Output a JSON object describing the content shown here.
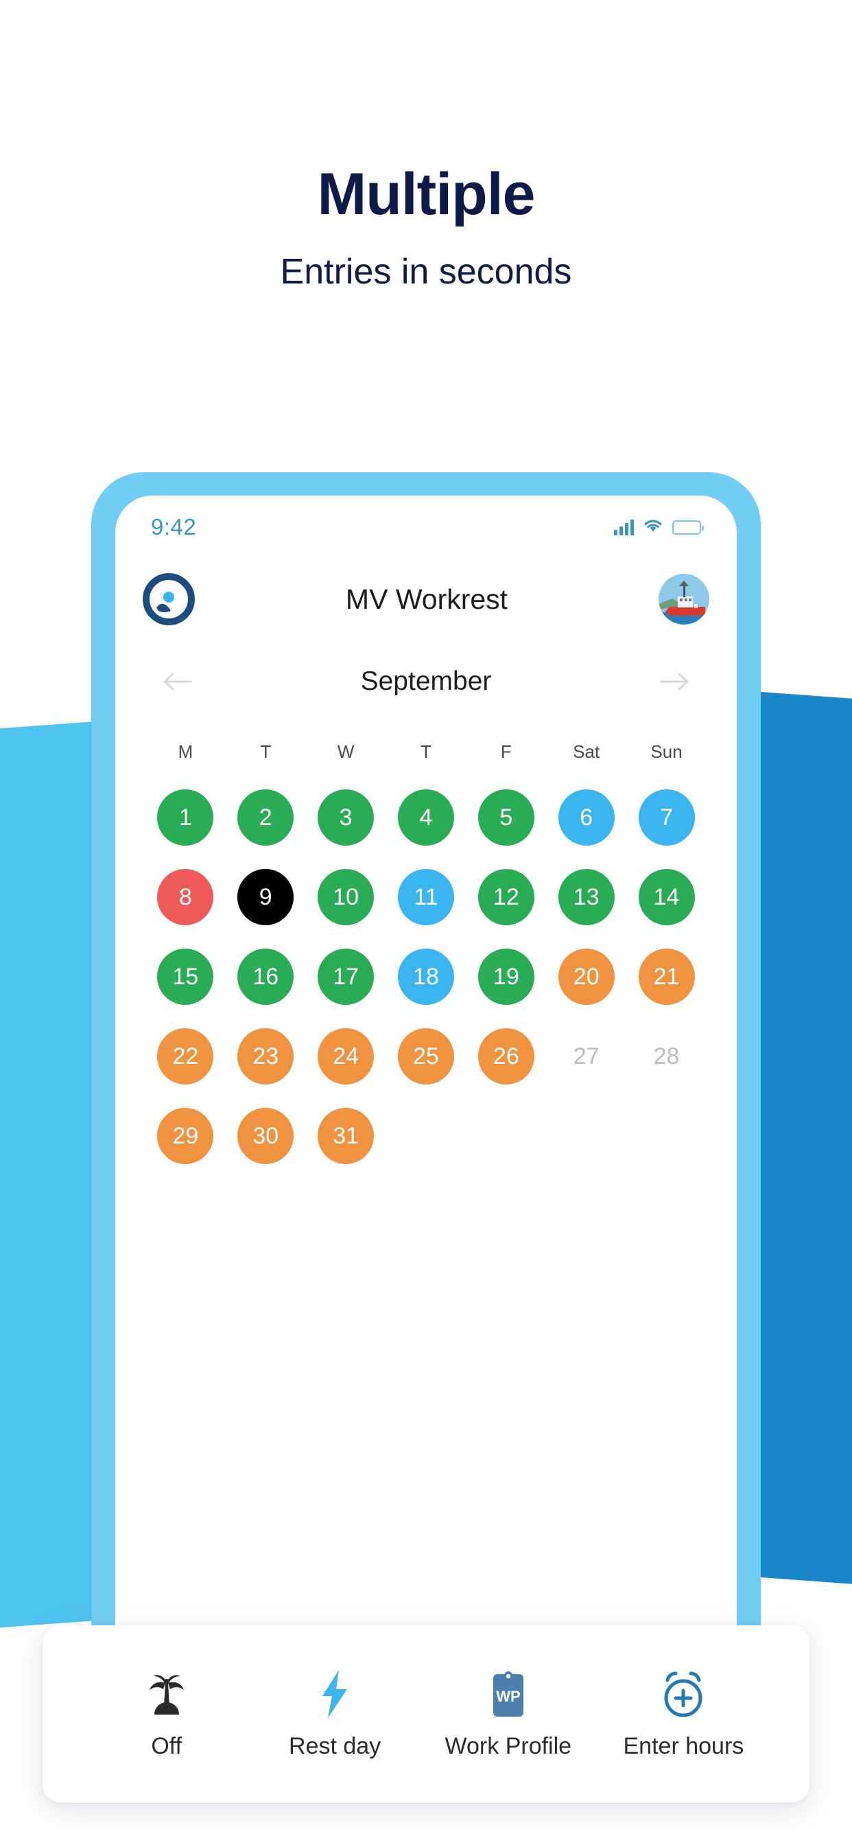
{
  "hero": {
    "title": "Multiple",
    "subtitle": "Entries in seconds",
    "title_color": "#0e1b48"
  },
  "phone": {
    "frame_color": "#72cdf4",
    "status_bar": {
      "time": "9:42",
      "tint_color": "#3a96bd",
      "signal_icon": "signal-bars-icon",
      "wifi_icon": "wifi-icon",
      "battery_icon": "battery-icon"
    },
    "header": {
      "logo_icon": "workrest-logo-icon",
      "title": "MV Workrest",
      "avatar_icon": "vessel-avatar"
    },
    "month_nav": {
      "prev_icon": "arrow-left-icon",
      "month": "September",
      "next_icon": "arrow-right-icon"
    },
    "calendar": {
      "weekdays": [
        "M",
        "T",
        "W",
        "T",
        "F",
        "Sat",
        "Sun"
      ],
      "legend_colors": {
        "work": "#2aab55",
        "rest": "#3ab5ef",
        "off": "#ee5a5a",
        "selected": "#000000",
        "overtime": "#ef9341",
        "inactive": "#bcbcbc"
      },
      "rows": [
        [
          {
            "day": "1",
            "state": "work"
          },
          {
            "day": "2",
            "state": "work"
          },
          {
            "day": "3",
            "state": "work"
          },
          {
            "day": "4",
            "state": "work"
          },
          {
            "day": "5",
            "state": "work"
          },
          {
            "day": "6",
            "state": "rest"
          },
          {
            "day": "7",
            "state": "rest"
          }
        ],
        [
          {
            "day": "8",
            "state": "off"
          },
          {
            "day": "9",
            "state": "selected"
          },
          {
            "day": "10",
            "state": "work"
          },
          {
            "day": "11",
            "state": "rest"
          },
          {
            "day": "12",
            "state": "work"
          },
          {
            "day": "13",
            "state": "work"
          },
          {
            "day": "14",
            "state": "work"
          }
        ],
        [
          {
            "day": "15",
            "state": "work"
          },
          {
            "day": "16",
            "state": "work"
          },
          {
            "day": "17",
            "state": "work"
          },
          {
            "day": "18",
            "state": "rest"
          },
          {
            "day": "19",
            "state": "work"
          },
          {
            "day": "20",
            "state": "overtime"
          },
          {
            "day": "21",
            "state": "overtime"
          }
        ],
        [
          {
            "day": "22",
            "state": "overtime"
          },
          {
            "day": "23",
            "state": "overtime"
          },
          {
            "day": "24",
            "state": "overtime"
          },
          {
            "day": "25",
            "state": "overtime"
          },
          {
            "day": "26",
            "state": "overtime"
          },
          {
            "day": "27",
            "state": "inactive"
          },
          {
            "day": "28",
            "state": "inactive"
          }
        ],
        [
          {
            "day": "29",
            "state": "overtime"
          },
          {
            "day": "30",
            "state": "overtime"
          },
          {
            "day": "31",
            "state": "overtime"
          },
          {
            "day": "",
            "state": "empty"
          },
          {
            "day": "",
            "state": "empty"
          },
          {
            "day": "",
            "state": "empty"
          },
          {
            "day": "",
            "state": "empty"
          }
        ]
      ]
    }
  },
  "toolbar": {
    "items": [
      {
        "icon": "palm-tree-icon",
        "label": "Off",
        "color": "#2b2b2b"
      },
      {
        "icon": "lightning-bolt-icon",
        "label": "Rest day",
        "color": "#3ab5ef"
      },
      {
        "icon": "work-profile-badge-icon",
        "label": "Work Profile",
        "badge_text": "WP",
        "color": "#4a7fae"
      },
      {
        "icon": "alarm-clock-plus-icon",
        "label": "Enter hours",
        "color": "#2379b8"
      }
    ]
  },
  "background": {
    "left_shape_color": "#4fc3ef",
    "right_shape_color": "#1886c9"
  }
}
